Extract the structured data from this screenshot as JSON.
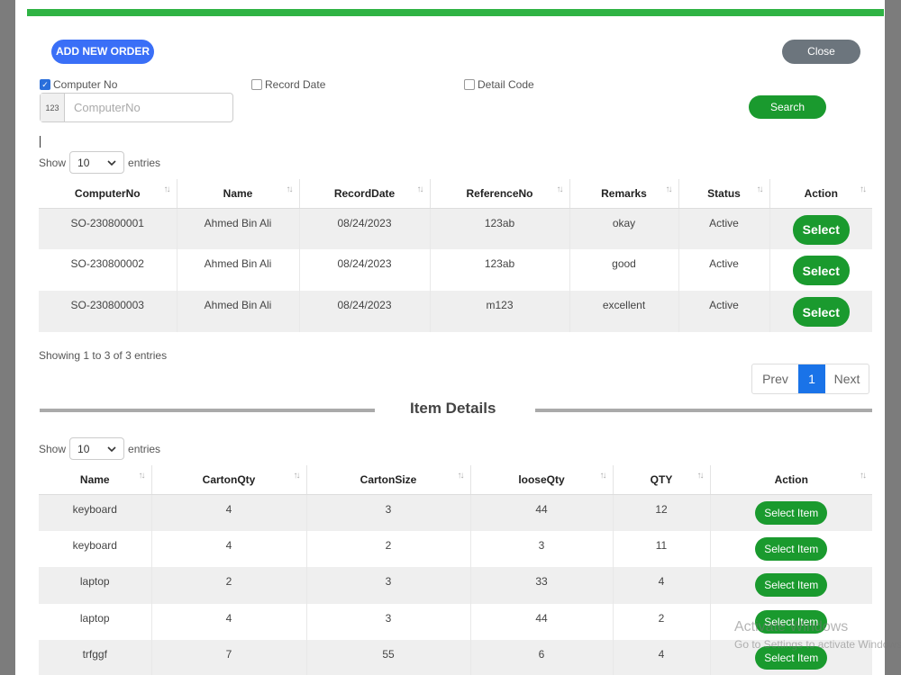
{
  "toolbar": {
    "add_label": "ADD NEW ORDER",
    "close_label": "Close",
    "search_label": "Search"
  },
  "filters": {
    "computer_no": "Computer No",
    "record_date": "Record Date",
    "detail_code": "Detail Code",
    "input_prefix": "123",
    "input_placeholder": "ComputerNo",
    "input_value": ""
  },
  "orders": {
    "show_label": "Show",
    "entries_label": "entries",
    "page_size": "10",
    "columns": [
      "ComputerNo",
      "Name",
      "RecordDate",
      "ReferenceNo",
      "Remarks",
      "Status",
      "Action"
    ],
    "rows": [
      {
        "computer_no": "SO-230800001",
        "name": "Ahmed Bin Ali",
        "date": "08/24/2023",
        "ref": "123ab",
        "remarks": "okay",
        "status": "Active",
        "action": "Select"
      },
      {
        "computer_no": "SO-230800002",
        "name": "Ahmed Bin Ali",
        "date": "08/24/2023",
        "ref": "123ab",
        "remarks": "good",
        "status": "Active",
        "action": "Select"
      },
      {
        "computer_no": "SO-230800003",
        "name": "Ahmed Bin Ali",
        "date": "08/24/2023",
        "ref": "m123",
        "remarks": "excellent",
        "status": "Active",
        "action": "Select"
      }
    ],
    "showing_text": "Showing 1 to 3 of 3 entries"
  },
  "pagination": {
    "prev": "Prev",
    "current": "1",
    "next": "Next"
  },
  "items": {
    "section_title": "Item Details",
    "show_label": "Show",
    "entries_label": "entries",
    "page_size": "10",
    "columns": [
      "Name",
      "CartonQty",
      "CartonSize",
      "looseQty",
      "QTY",
      "Action"
    ],
    "rows": [
      {
        "name": "keyboard",
        "carton_qty": "4",
        "carton_size": "3",
        "loose_qty": "44",
        "qty": "12",
        "action": "Select Item"
      },
      {
        "name": "keyboard",
        "carton_qty": "4",
        "carton_size": "2",
        "loose_qty": "3",
        "qty": "11",
        "action": "Select Item"
      },
      {
        "name": "laptop",
        "carton_qty": "2",
        "carton_size": "3",
        "loose_qty": "33",
        "qty": "4",
        "action": "Select Item"
      },
      {
        "name": "laptop",
        "carton_qty": "4",
        "carton_size": "3",
        "loose_qty": "44",
        "qty": "2",
        "action": "Select Item"
      },
      {
        "name": "trfggf",
        "carton_qty": "7",
        "carton_size": "55",
        "loose_qty": "6",
        "qty": "4",
        "action": "Select Item"
      }
    ]
  },
  "watermark": {
    "line1": "Activate Windows",
    "line2": "Go to Settings to activate Windows."
  },
  "colors": {
    "accent_green": "#1a9a2e",
    "top_bar": "#2fb344",
    "primary_blue": "#3a6ff7",
    "page_active": "#1a73e8"
  }
}
